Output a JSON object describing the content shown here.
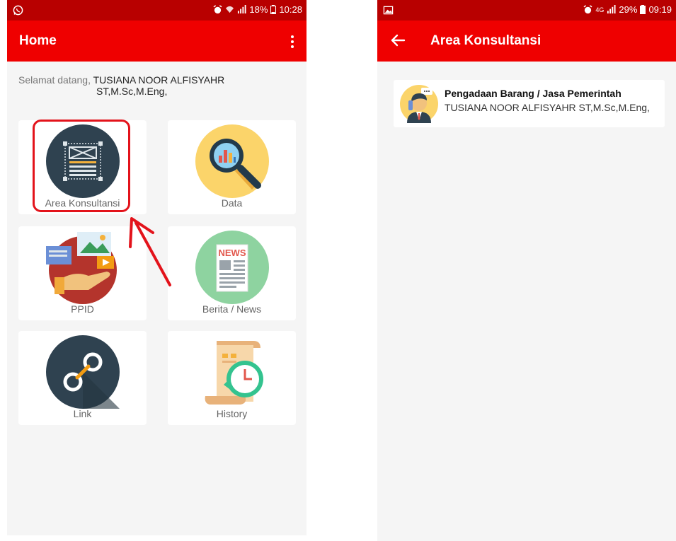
{
  "left_screen": {
    "status": {
      "battery": "18%",
      "time": "10:28"
    },
    "appbar": {
      "title": "Home"
    },
    "welcome": {
      "prefix": "Selamat datang, ",
      "name_line1": "TUSIANA NOOR ALFISYAHR",
      "name_line2": "ST,M.Sc,M.Eng,"
    },
    "tiles": [
      {
        "label": "Area Konsultansi",
        "icon": "area-konsultansi-icon"
      },
      {
        "label": "Data",
        "icon": "data-magnifier-icon"
      },
      {
        "label": "PPID",
        "icon": "ppid-icon"
      },
      {
        "label": "Berita / News",
        "icon": "news-icon"
      },
      {
        "label": "Link",
        "icon": "link-icon"
      },
      {
        "label": "History",
        "icon": "history-icon"
      }
    ],
    "news_icon_text": "NEWS"
  },
  "right_screen": {
    "status": {
      "network": "4G",
      "battery": "29%",
      "time": "09:19"
    },
    "appbar": {
      "title": "Area Konsultansi"
    },
    "list": [
      {
        "title": "Pengadaan Barang / Jasa Pemerintah",
        "subtitle": "TUSIANA NOOR ALFISYAHR ST,M.Sc,M.Eng,",
        "icon": "consultant-avatar-icon"
      }
    ]
  },
  "colors": {
    "status_bar": "#b80000",
    "app_bar": "#ef0000",
    "highlight": "#e3131b",
    "background": "#f5f5f5"
  }
}
